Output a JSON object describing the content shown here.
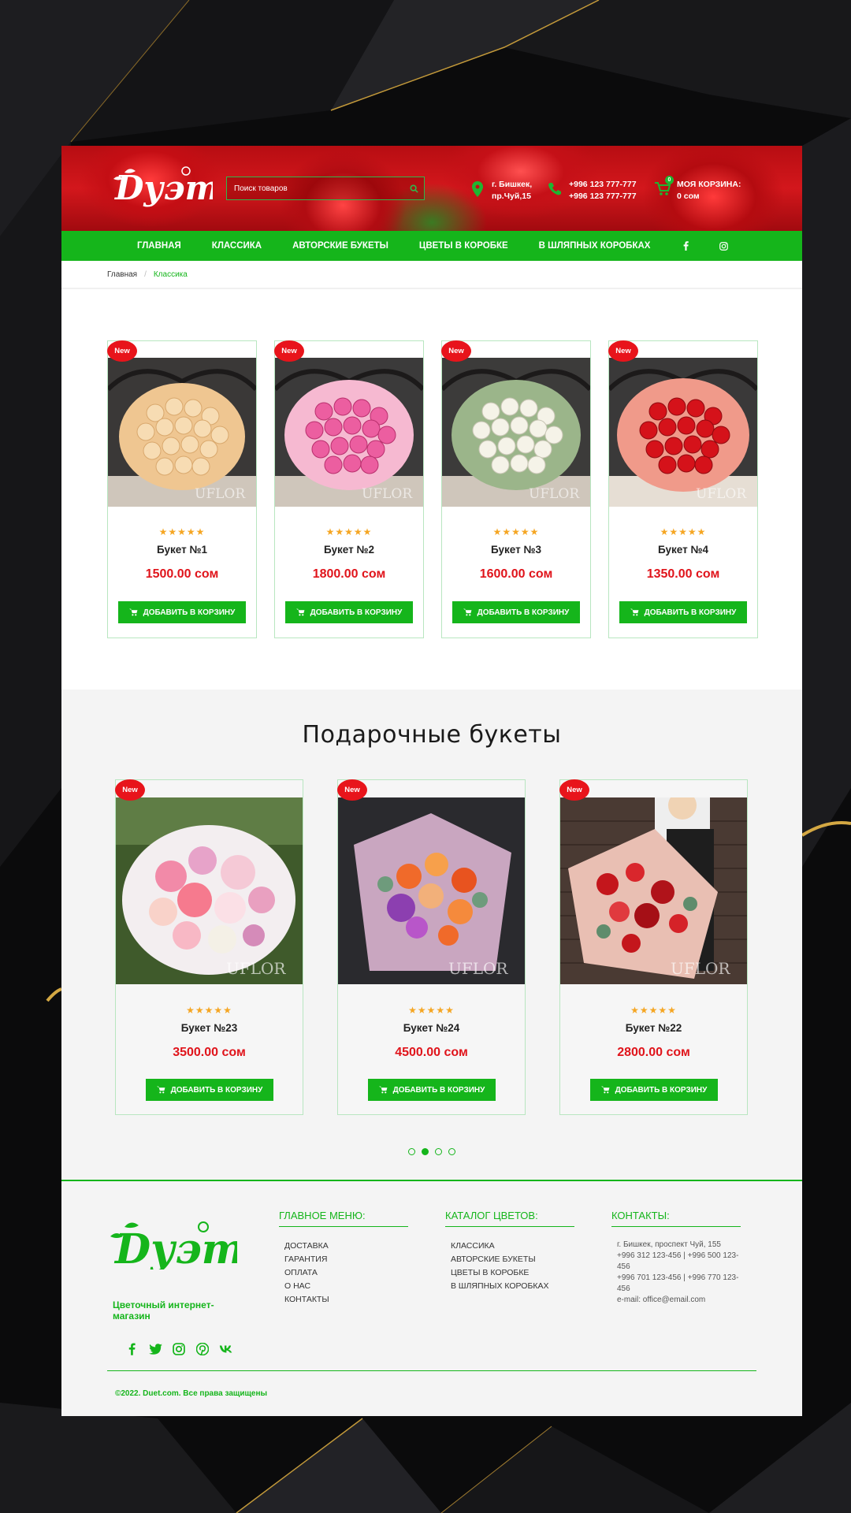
{
  "header": {
    "search_placeholder": "Поиск товаров",
    "address_line1": "г. Бишкек,",
    "address_line2": "пр.Чуй,15",
    "phone1": "+996 123 777-777",
    "phone2": "+996 123 777-777",
    "cart_title": "МОЯ КОРЗИНА:",
    "cart_total": "0 сом",
    "cart_count": "0"
  },
  "nav": {
    "items": [
      "ГЛАВНАЯ",
      "КЛАССИКА",
      "АВТОРСКИЕ БУКЕТЫ",
      "ЦВЕТЫ В КОРОБКЕ",
      "В ШЛЯПНЫХ КОРОБКАХ"
    ]
  },
  "breadcrumb": {
    "home": "Главная",
    "separator": "/",
    "current": "Классика"
  },
  "products": [
    {
      "badge": "New",
      "stars": "★★★★★",
      "name": "Букет №1",
      "price": "1500.00 сом",
      "button": "ДОБАВИТЬ В КОРЗИНУ",
      "color": "#f6d3a6"
    },
    {
      "badge": "New",
      "stars": "★★★★★",
      "name": "Букет №2",
      "price": "1800.00 сом",
      "button": "ДОБАВИТЬ В КОРЗИНУ",
      "color": "#e8559a"
    },
    {
      "badge": "New",
      "stars": "★★★★★",
      "name": "Букет №3",
      "price": "1600.00 сом",
      "button": "ДОБАВИТЬ В КОРЗИНУ",
      "color": "#f2f0e6"
    },
    {
      "badge": "New",
      "stars": "★★★★★",
      "name": "Букет №4",
      "price": "1350.00 сом",
      "button": "ДОБАВИТЬ В КОРЗИНУ",
      "color": "#d4141b"
    }
  ],
  "gift": {
    "title": "Подарочные букеты",
    "items": [
      {
        "badge": "New",
        "stars": "★★★★★",
        "name": "Букет №23",
        "price": "3500.00 сом",
        "button": "ДОБАВИТЬ В КОРЗИНУ"
      },
      {
        "badge": "New",
        "stars": "★★★★★",
        "name": "Букет №24",
        "price": "4500.00 сом",
        "button": "ДОБАВИТЬ В КОРЗИНУ"
      },
      {
        "badge": "New",
        "stars": "★★★★★",
        "name": "Букет №22",
        "price": "2800.00 сом",
        "button": "ДОБАВИТЬ В КОРЗИНУ"
      }
    ],
    "slides": 4,
    "active_slide": 2
  },
  "footer": {
    "tagline": "Цветочный интернет-магазин",
    "menu_title": "ГЛАВНОЕ МЕНЮ:",
    "menu_items": [
      "ДОСТАВКА",
      "ГАРАНТИЯ",
      "ОПЛАТА",
      "О НАС",
      "КОНТАКТЫ"
    ],
    "catalog_title": "КАТАЛОГ ЦВЕТОВ:",
    "catalog_items": [
      "КЛАССИКА",
      "АВТОРСКИЕ БУКЕТЫ",
      "ЦВЕТЫ В КОРОБКЕ",
      "В ШЛЯПНЫХ КОРОБКАХ"
    ],
    "contacts_title": "КОНТАКТЫ:",
    "contacts": [
      "г. Бишкек, проспект Чуй, 155",
      "+996 312 123-456 | +996 500 123-456",
      "+996 701 123-456 | +996 770 123-456",
      "e-mail: office@email.com"
    ],
    "copyright": "©2022. Duet.com. Все права защищены"
  },
  "colors": {
    "brand_green": "#15b51b",
    "price_red": "#e0141b",
    "badge_red": "#e8141b",
    "star": "#f5a623"
  },
  "icons": [
    "search-icon",
    "map-pin-icon",
    "phone-icon",
    "cart-icon",
    "facebook-icon",
    "instagram-icon",
    "twitter-icon",
    "pinterest-icon",
    "vk-icon"
  ]
}
